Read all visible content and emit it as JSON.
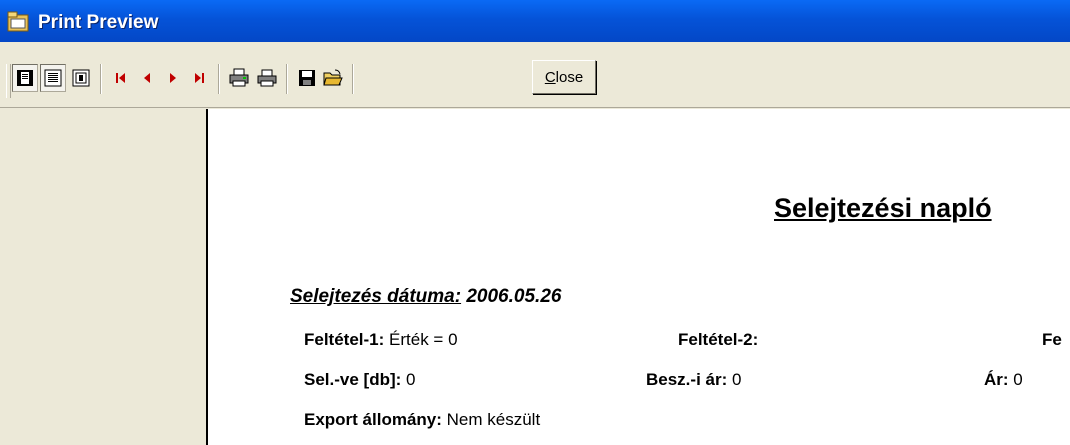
{
  "window": {
    "title": "Print Preview"
  },
  "toolbar": {
    "buttons": [
      {
        "name": "one-page-icon",
        "pressed": true
      },
      {
        "name": "two-page-icon",
        "pressed": true
      },
      {
        "name": "zoom-icon",
        "pressed": false
      },
      {
        "name": "first-page-icon",
        "pressed": false
      },
      {
        "name": "previous-page-icon",
        "pressed": false
      },
      {
        "name": "next-page-icon",
        "pressed": false
      },
      {
        "name": "last-page-icon",
        "pressed": false
      },
      {
        "name": "printer-setup-icon",
        "pressed": false
      },
      {
        "name": "print-icon",
        "pressed": false
      },
      {
        "name": "save-icon",
        "pressed": false
      },
      {
        "name": "open-folder-icon",
        "pressed": false
      }
    ],
    "close_label_underlined": "C",
    "close_label_rest": "lose"
  },
  "document": {
    "title": "Selejtezési napló",
    "date_label": "Selejtezés dátuma:",
    "date_value": "2006.05.26",
    "fields": {
      "felt1_label": "Feltétel-1:",
      "felt1_value": "Érték = 0",
      "felt2_label": "Feltétel-2:",
      "felt2_value": "",
      "felt3_label": "Fe",
      "selve_label": "Sel.-ve [db]:",
      "selve_value": "0",
      "besz_label": "Besz.-i ár:",
      "besz_value": "0",
      "ar_label": "Ár:",
      "ar_value": "0",
      "export_label": "Export állomány:",
      "export_value": "Nem készült"
    }
  },
  "colors": {
    "titlebar": "#0553d8",
    "nav_arrows": "#c00000",
    "chrome": "#ece9d8",
    "paper": "#ffffff"
  }
}
